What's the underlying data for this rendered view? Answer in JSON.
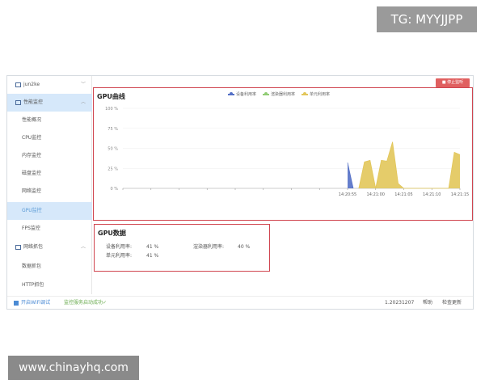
{
  "watermarks": {
    "top": "TG: MYYJJPP",
    "bottom": "www.chinayhq.com"
  },
  "sidebar": {
    "device": "jun2ke",
    "groups": [
      {
        "label": "性能监控",
        "items": [
          "性能概况",
          "CPU监控",
          "内存监控",
          "磁盘监控",
          "网络监控",
          "GPU监控",
          "FPS监控"
        ]
      },
      {
        "label": "网络抓包",
        "items": [
          "数据抓包",
          "HTTP抓包"
        ]
      }
    ],
    "active_item": "GPU监控"
  },
  "toolbar": {
    "stop_label": "停止监听"
  },
  "gpu_chart": {
    "title": "GPU曲线"
  },
  "gpu_data": {
    "title": "GPU数据",
    "device_label": "设备利用率:",
    "device_value": "41 %",
    "renderer_label": "渲染器利用率:",
    "renderer_value": "40 %",
    "unit_label": "单元利用率:",
    "unit_value": "41 %"
  },
  "footer": {
    "wifi_label": "开启WiFi调试",
    "wifi_checked": true,
    "status": "监控服务启动成功✓",
    "version": "1.20231207",
    "help": "帮助",
    "update": "检查更新"
  },
  "chart_data": {
    "type": "area",
    "title": "GPU曲线",
    "ylim": [
      0,
      100
    ],
    "y_ticks": [
      "0 %",
      "25 %",
      "50 %",
      "75 %",
      "100 %"
    ],
    "x_ticks": [
      "14:20:55",
      "14:21:00",
      "14:21:05",
      "14:21:10",
      "14:21:15"
    ],
    "x_range": [
      "14:20:15",
      "14:21:15"
    ],
    "grid": true,
    "legend": "top",
    "series": [
      {
        "name": "设备利用率",
        "color": "#5470c6",
        "points": [
          [
            "14:20:55",
            32
          ],
          [
            "14:20:56",
            0
          ]
        ]
      },
      {
        "name": "渲染器利用率",
        "color": "#91cc75",
        "points": []
      },
      {
        "name": "单元利用率",
        "color": "#e2c65a",
        "points": [
          [
            "14:20:57",
            0
          ],
          [
            "14:20:58",
            33
          ],
          [
            "14:20:59",
            35
          ],
          [
            "14:21:00",
            0
          ],
          [
            "14:21:01",
            35
          ],
          [
            "14:21:02",
            34
          ],
          [
            "14:21:03",
            58
          ],
          [
            "14:21:04",
            6
          ],
          [
            "14:21:05",
            0
          ],
          [
            "14:21:13",
            0
          ],
          [
            "14:21:14",
            45
          ],
          [
            "14:21:15",
            42
          ]
        ]
      }
    ]
  }
}
